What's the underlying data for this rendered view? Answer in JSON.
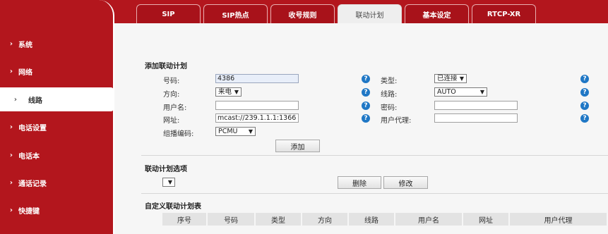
{
  "tabs": [
    {
      "label": "SIP",
      "active": false
    },
    {
      "label": "SIP热点",
      "active": false
    },
    {
      "label": "收号规则",
      "active": false
    },
    {
      "label": "联动计划",
      "active": true
    },
    {
      "label": "基本设定",
      "active": false
    },
    {
      "label": "RTCP-XR",
      "active": false
    }
  ],
  "sidebar": {
    "items": [
      {
        "label": "系统",
        "active": false
      },
      {
        "label": "网络",
        "active": false
      },
      {
        "label": "线路",
        "active": true
      },
      {
        "label": "电话设置",
        "active": false
      },
      {
        "label": "电话本",
        "active": false
      },
      {
        "label": "通话记录",
        "active": false
      },
      {
        "label": "快捷键",
        "active": false
      }
    ],
    "chevron": "›"
  },
  "add_plan": {
    "title": "添加联动计划",
    "number_label": "号码:",
    "number_value": "4386",
    "type_label": "类型:",
    "type_value": "已连接",
    "direction_label": "方向:",
    "direction_value": "来电",
    "line_label": "线路:",
    "line_value": "AUTO",
    "username_label": "用户名:",
    "username_value": "",
    "password_label": "密码:",
    "password_value": "",
    "url_label": "网址:",
    "url_value": "mcast://239.1.1.1:1366",
    "useragent_label": "用户代理:",
    "useragent_value": "",
    "codec_label": "组播编码:",
    "codec_value": "PCMU",
    "add_button": "添加",
    "help_glyph": "?"
  },
  "options": {
    "title": "联动计划选项",
    "select_value": "",
    "delete_button": "删除",
    "modify_button": "修改"
  },
  "table": {
    "title": "自定义联动计划表",
    "columns": [
      "序号",
      "号码",
      "类型",
      "方向",
      "线路",
      "用户名",
      "网址",
      "用户代理"
    ]
  },
  "colors": {
    "brand_red": "#b3161d",
    "help_blue": "#1f77c5"
  },
  "icons": {
    "dropdown": "▼",
    "chevron": "›",
    "help": "question-icon"
  }
}
